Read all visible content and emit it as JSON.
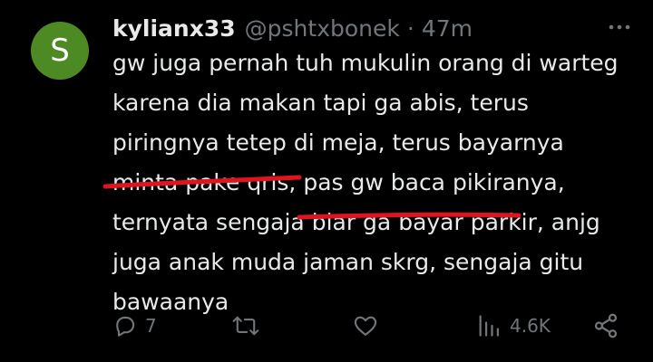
{
  "tweet": {
    "avatar_letter": "S",
    "avatar_color": "#4e8a24",
    "display_name": "kylianx33",
    "handle": "@pshtxbonek",
    "separator": "·",
    "time": "47m",
    "text": "gw juga pernah tuh mukulin orang di warteg\nkarena dia makan tapi ga abis, terus\npiringnya tetep di meja, terus bayarnya\nminta pake qris, pas gw baca pikiranya,\nternyata sengaja biar ga bayar parkir, anjg\njuga anak muda jaman skrg, sengaja gitu\nbawaanya",
    "annotation_color": "#e0141e"
  },
  "actions": {
    "reply_count": "7",
    "retweet_count": "",
    "like_count": "",
    "views_count": "4.6K",
    "icons": [
      "reply-icon",
      "retweet-icon",
      "like-icon",
      "views-icon",
      "share-icon"
    ]
  },
  "colors": {
    "background": "#000000",
    "text": "#e7e9ea",
    "muted": "#71767b"
  }
}
